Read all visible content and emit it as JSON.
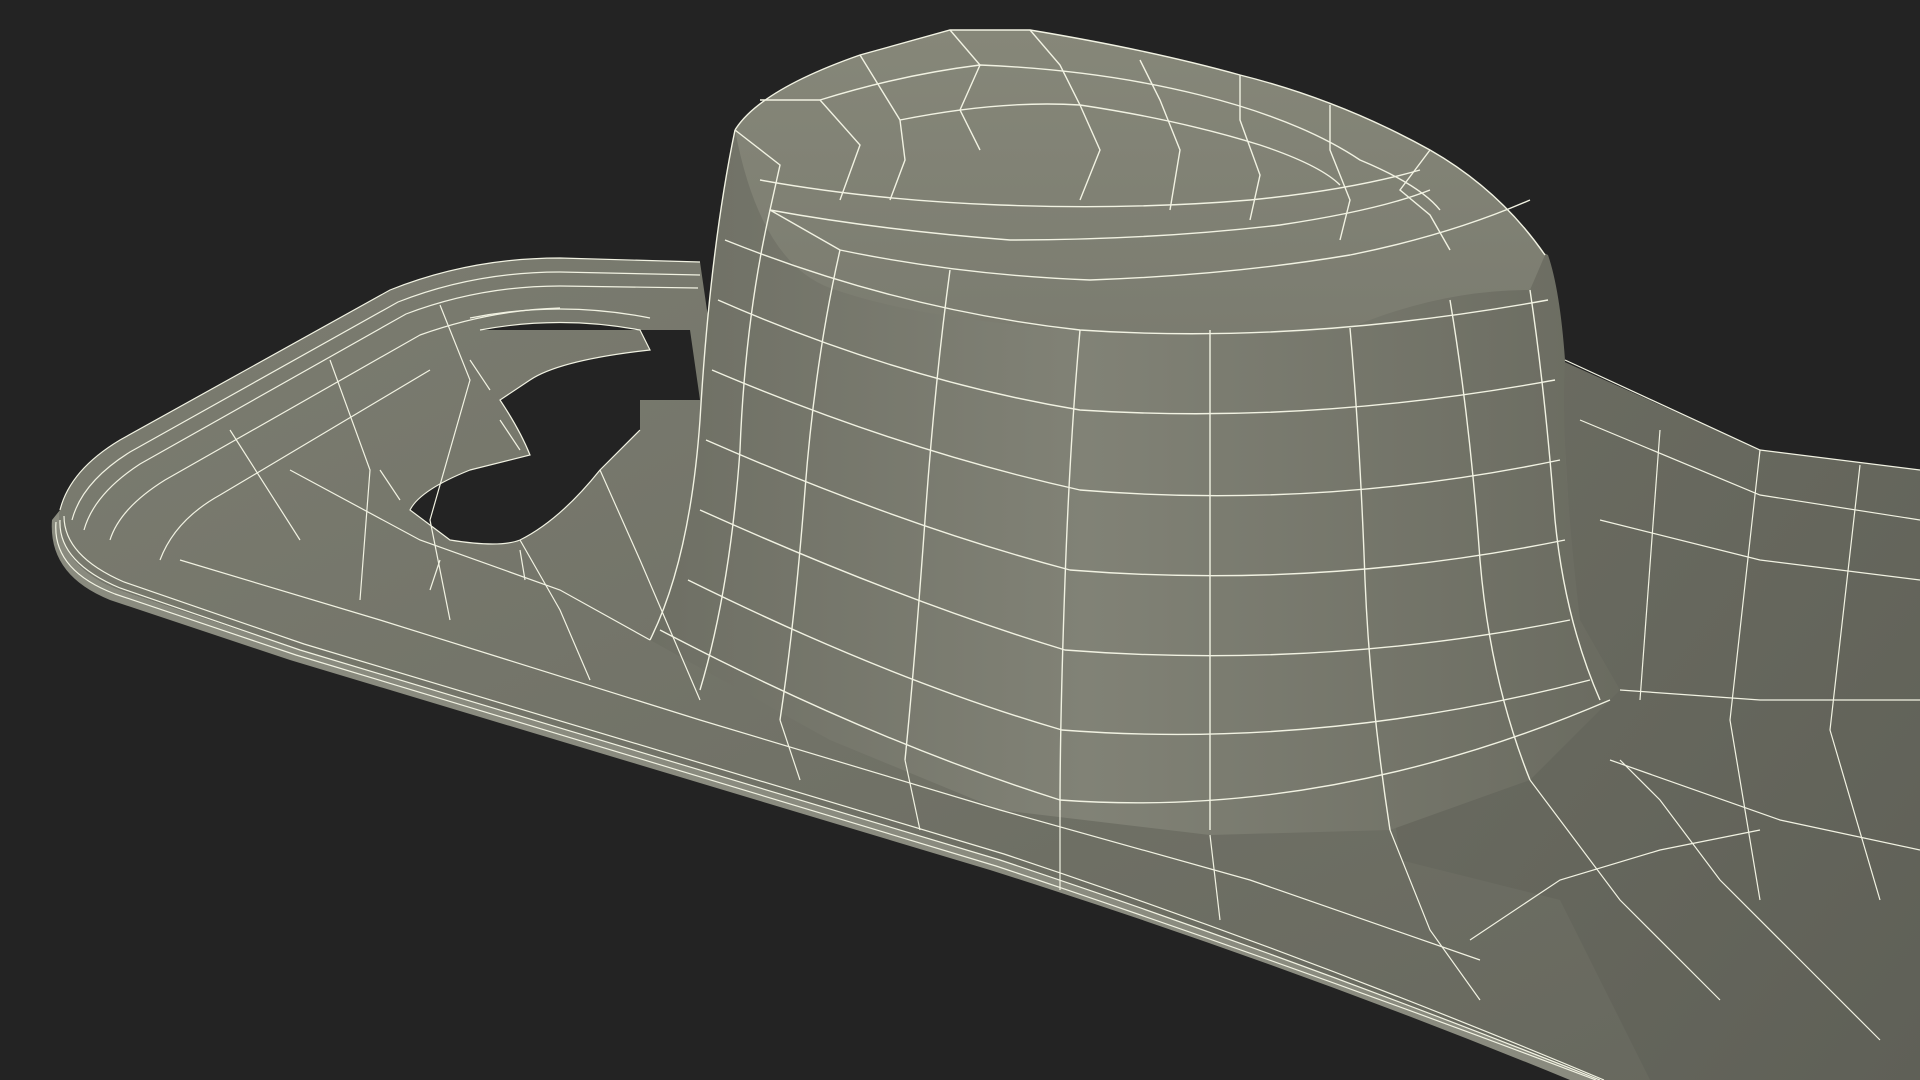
{
  "viewport": {
    "background_color": "#232323"
  },
  "model": {
    "description_shown": false,
    "surface_color": "#7a7b6f",
    "surface_shadow_color": "#5a5b52",
    "surface_highlight_color": "#85867a",
    "wire_color": "#f1f2e2",
    "hole_color": "#232323"
  }
}
